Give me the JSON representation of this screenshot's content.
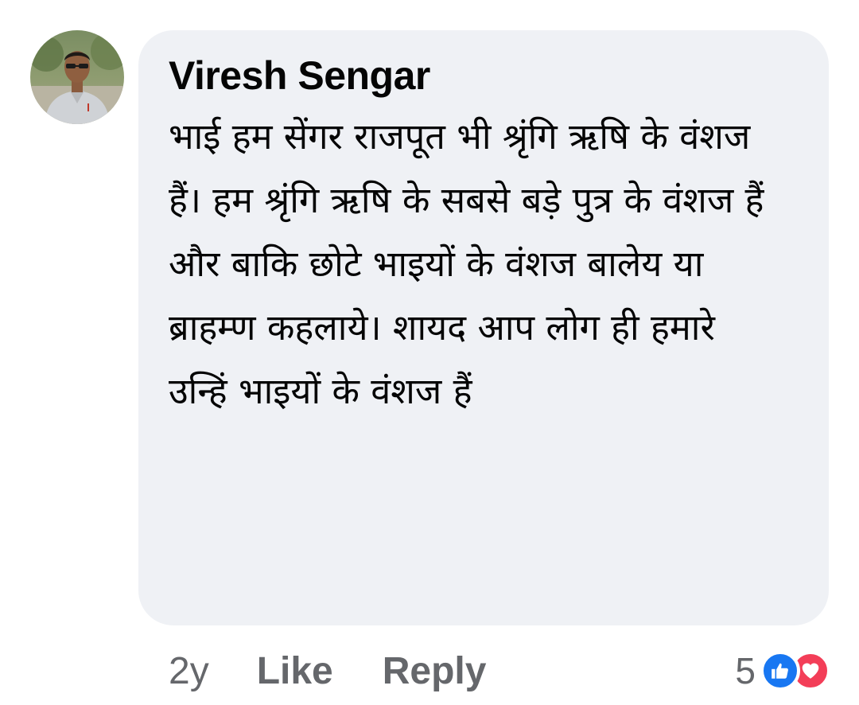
{
  "comment": {
    "author": "Viresh Sengar",
    "text": "भाई हम सेंगर राजपूत भी श्रृंगि ऋषि के वंशज हैं। हम श्रृंगि ऋषि के सबसे बड़े पुत्र के वंशज हैं और बाकि छोटे भाइयों के वंशज बालेय या ब्राहम्ण कहलाये। शायद आप लोग ही हमारे उन्हिं भाइयों के वंशज हैं",
    "avatar_icon": "profile-photo-man-in-sunglasses",
    "bubble_color": "#eff1f5"
  },
  "actions": {
    "time": "2y",
    "like_label": "Like",
    "reply_label": "Reply"
  },
  "reactions": {
    "count": "5",
    "icons": [
      "like-icon",
      "love-icon"
    ],
    "like_color": "#1877f2",
    "love_color": "#f33e58"
  }
}
